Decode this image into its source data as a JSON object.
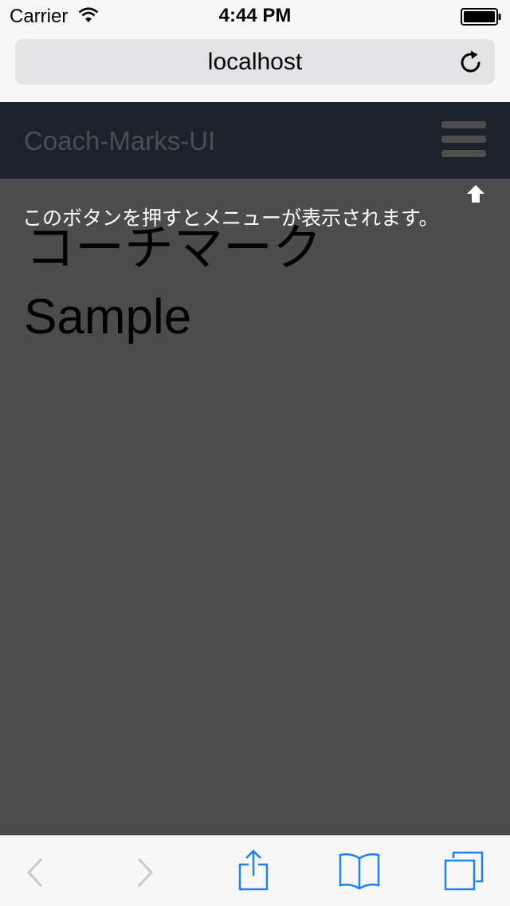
{
  "status_bar": {
    "carrier": "Carrier",
    "time": "4:44 PM",
    "icons": [
      "wifi-icon",
      "battery-icon"
    ]
  },
  "address_bar": {
    "url": "localhost",
    "reload_icon": "reload-icon"
  },
  "navbar": {
    "brand": "Coach-Marks-UI",
    "menu_icon": "hamburger-menu-icon"
  },
  "main": {
    "title": "コーチマーク",
    "subtitle": "Sample"
  },
  "coach_mark": {
    "text": "このボタンを押すとメニューが表示されます。",
    "arrow_icon": "arrow-up-icon"
  },
  "toolbar": {
    "icons": [
      "back-icon",
      "forward-icon",
      "share-icon",
      "bookmarks-icon",
      "tabs-icon"
    ]
  },
  "colors": {
    "navbar_bg": "#1b2229",
    "overlay_bg": "#4c4c4c",
    "ios_blue": "#1a82fb",
    "disabled_gray": "#c7c7cc"
  }
}
